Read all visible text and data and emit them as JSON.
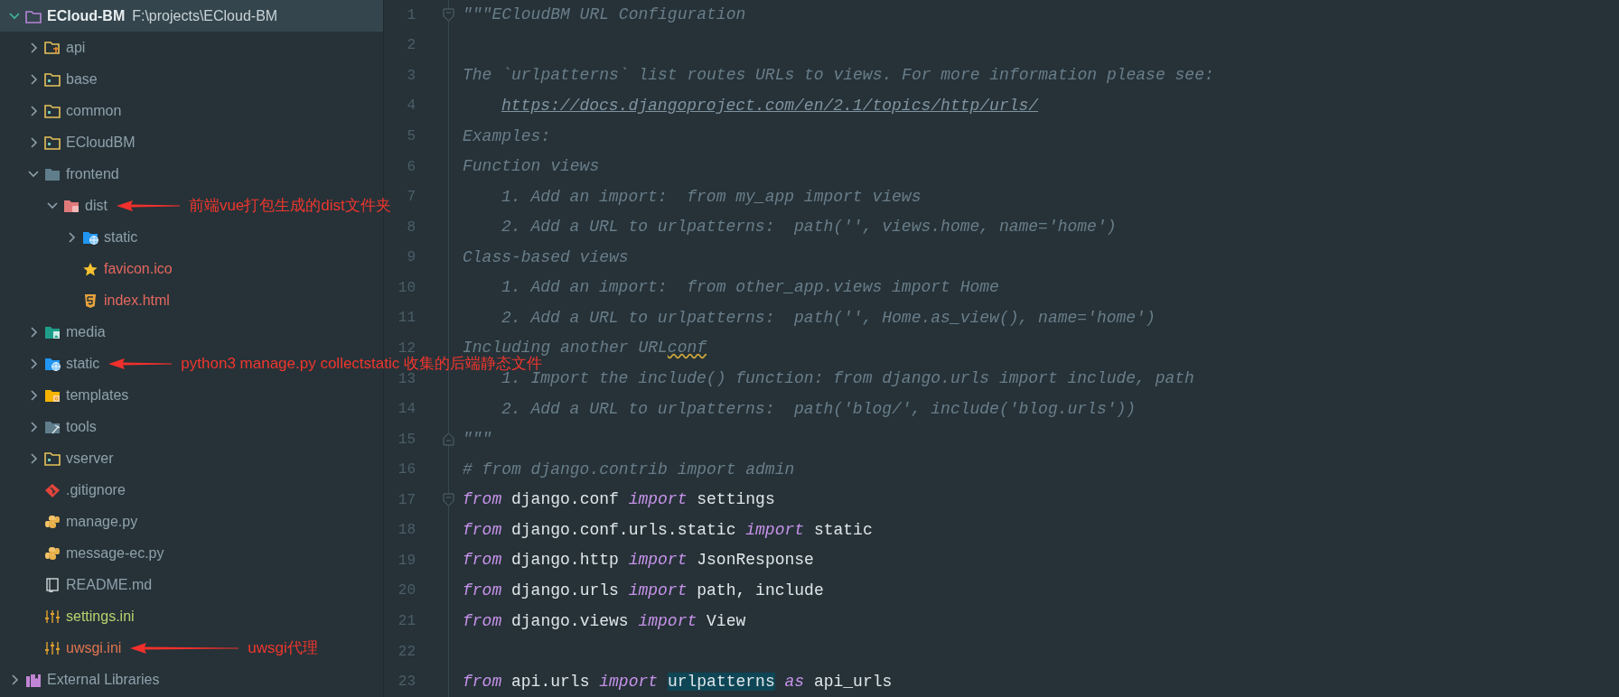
{
  "project_tree": {
    "root": {
      "name": "ECloud-BM",
      "path": "F:\\projects\\ECloud-BM",
      "kind": "project",
      "expanded": true,
      "selected": true,
      "color": "#e8eef0",
      "children": [
        {
          "name": "api",
          "kind": "folder-api",
          "expanded": false,
          "selected": false,
          "color": "#8fa1ab"
        },
        {
          "name": "base",
          "kind": "package",
          "expanded": false,
          "selected": false,
          "color": "#8fa1ab"
        },
        {
          "name": "common",
          "kind": "package",
          "expanded": false,
          "selected": false,
          "color": "#8fa1ab"
        },
        {
          "name": "ECloudBM",
          "kind": "package",
          "expanded": false,
          "selected": false,
          "color": "#8fa1ab"
        },
        {
          "name": "frontend",
          "kind": "folder",
          "expanded": true,
          "selected": false,
          "color": "#8fa1ab",
          "children": [
            {
              "name": "dist",
              "kind": "folder-excluded",
              "expanded": true,
              "selected": false,
              "color": "#8fa1ab",
              "annotation": "前端vue打包生成的dist文件夹",
              "children": [
                {
                  "name": "static",
                  "kind": "folder-web",
                  "expanded": false,
                  "selected": false,
                  "color": "#8fa1ab"
                },
                {
                  "name": "favicon.ico",
                  "kind": "star",
                  "selected": false,
                  "color": "#e5675f"
                },
                {
                  "name": "index.html",
                  "kind": "html",
                  "selected": false,
                  "color": "#e5675f"
                }
              ]
            }
          ]
        },
        {
          "name": "media",
          "kind": "folder-media",
          "expanded": false,
          "selected": false,
          "color": "#8fa1ab"
        },
        {
          "name": "static",
          "kind": "folder-web",
          "expanded": false,
          "selected": false,
          "color": "#8fa1ab",
          "annotation": "python3 manage.py collectstatic 收集的后端静态文件"
        },
        {
          "name": "templates",
          "kind": "folder-templates",
          "expanded": false,
          "selected": false,
          "color": "#8fa1ab"
        },
        {
          "name": "tools",
          "kind": "folder-tools",
          "expanded": false,
          "selected": false,
          "color": "#8fa1ab"
        },
        {
          "name": "vserver",
          "kind": "package",
          "expanded": false,
          "selected": false,
          "color": "#8fa1ab"
        },
        {
          "name": ".gitignore",
          "kind": "git",
          "selected": false,
          "color": "#8fa1ab"
        },
        {
          "name": "manage.py",
          "kind": "python",
          "selected": false,
          "color": "#8fa1ab"
        },
        {
          "name": "message-ec.py",
          "kind": "python",
          "selected": false,
          "color": "#8fa1ab"
        },
        {
          "name": "README.md",
          "kind": "book",
          "selected": false,
          "color": "#8fa1ab"
        },
        {
          "name": "settings.ini",
          "kind": "sliders",
          "selected": false,
          "color": "#b9d26e"
        },
        {
          "name": "uwsgi.ini",
          "kind": "sliders",
          "selected": false,
          "color": "#e2744f",
          "annotation": "uwsgi代理"
        }
      ]
    },
    "external": {
      "name": "External Libraries",
      "kind": "library",
      "expanded": false,
      "selected": false,
      "color": "#8fa1ab"
    }
  },
  "editor": {
    "lines": [
      {
        "number": "1",
        "kind": "fold-start",
        "tokens": [
          {
            "kind": "doc",
            "text": "\"\"\"ECloudBM URL Configuration"
          }
        ]
      },
      {
        "number": "2"
      },
      {
        "number": "3",
        "tokens": [
          {
            "kind": "doc",
            "text": "The `urlpatterns` list routes URLs to views. For more information please see:"
          }
        ]
      },
      {
        "number": "4",
        "indented": true,
        "tokens": [
          {
            "kind": "link",
            "text": "https://docs.djangoproject.com/en/2.1/topics/http/urls/"
          }
        ]
      },
      {
        "number": "5",
        "tokens": [
          {
            "kind": "doc",
            "text": "Examples:"
          }
        ]
      },
      {
        "number": "6",
        "tokens": [
          {
            "kind": "doc",
            "text": "Function views"
          }
        ]
      },
      {
        "number": "7",
        "indented": true,
        "tokens": [
          {
            "kind": "doc",
            "text": "1. Add an import:  from my_app import views"
          }
        ]
      },
      {
        "number": "8",
        "indented": true,
        "tokens": [
          {
            "kind": "doc",
            "text": "2. Add a URL to urlpatterns:  path('', views.home, name='home')"
          }
        ]
      },
      {
        "number": "9",
        "tokens": [
          {
            "kind": "doc",
            "text": "Class-based views"
          }
        ]
      },
      {
        "number": "10",
        "indented": true,
        "tokens": [
          {
            "kind": "doc",
            "text": "1. Add an import:  from other_app.views import Home"
          }
        ]
      },
      {
        "number": "11",
        "indented": true,
        "tokens": [
          {
            "kind": "doc",
            "text": "2. Add a URL to urlpatterns:  path('', Home.as_view(), name='home')"
          }
        ]
      },
      {
        "number": "12",
        "tokens": [
          {
            "kind": "doc",
            "text": "Including another URL"
          },
          {
            "kind": "typo",
            "text": "conf"
          }
        ]
      },
      {
        "number": "13",
        "indented": true,
        "tokens": [
          {
            "kind": "doc",
            "text": "1. Import the include() function: from django.urls import include, path"
          }
        ]
      },
      {
        "number": "14",
        "indented": true,
        "tokens": [
          {
            "kind": "doc",
            "text": "2. Add a URL to urlpatterns:  path('blog/', include('blog.urls'))"
          }
        ]
      },
      {
        "number": "15",
        "kind": "fold-end",
        "tokens": [
          {
            "kind": "doc",
            "text": "\"\"\""
          }
        ]
      },
      {
        "number": "16",
        "tokens": [
          {
            "kind": "doc",
            "text": "# from django.contrib import admin"
          }
        ]
      },
      {
        "number": "17",
        "kind": "fold-start",
        "tokens": [
          {
            "kind": "keyword",
            "text": "from"
          },
          {
            "kind": "plain",
            "text": " django.conf "
          },
          {
            "kind": "keyword",
            "text": "import"
          },
          {
            "kind": "plain",
            "text": " settings"
          }
        ]
      },
      {
        "number": "18",
        "tokens": [
          {
            "kind": "keyword",
            "text": "from"
          },
          {
            "kind": "plain",
            "text": " django.conf.urls.static "
          },
          {
            "kind": "keyword",
            "text": "import"
          },
          {
            "kind": "plain",
            "text": " static"
          }
        ]
      },
      {
        "number": "19",
        "tokens": [
          {
            "kind": "keyword",
            "text": "from"
          },
          {
            "kind": "plain",
            "text": " django.http "
          },
          {
            "kind": "keyword",
            "text": "import"
          },
          {
            "kind": "plain",
            "text": " JsonResponse"
          }
        ]
      },
      {
        "number": "20",
        "tokens": [
          {
            "kind": "keyword",
            "text": "from"
          },
          {
            "kind": "plain",
            "text": " django.urls "
          },
          {
            "kind": "keyword",
            "text": "import"
          },
          {
            "kind": "plain",
            "text": " path, include"
          }
        ]
      },
      {
        "number": "21",
        "tokens": [
          {
            "kind": "keyword",
            "text": "from"
          },
          {
            "kind": "plain",
            "text": " django.views "
          },
          {
            "kind": "keyword",
            "text": "import"
          },
          {
            "kind": "plain",
            "text": " View"
          }
        ]
      },
      {
        "number": "22"
      },
      {
        "number": "23",
        "tokens": [
          {
            "kind": "keyword",
            "text": "from"
          },
          {
            "kind": "plain",
            "text": " api.urls "
          },
          {
            "kind": "keyword",
            "text": "import "
          },
          {
            "kind": "highlight",
            "text": "urlpatterns"
          },
          {
            "kind": "keyword",
            "text": " as"
          },
          {
            "kind": "plain",
            "text": " api_urls"
          }
        ]
      }
    ]
  }
}
